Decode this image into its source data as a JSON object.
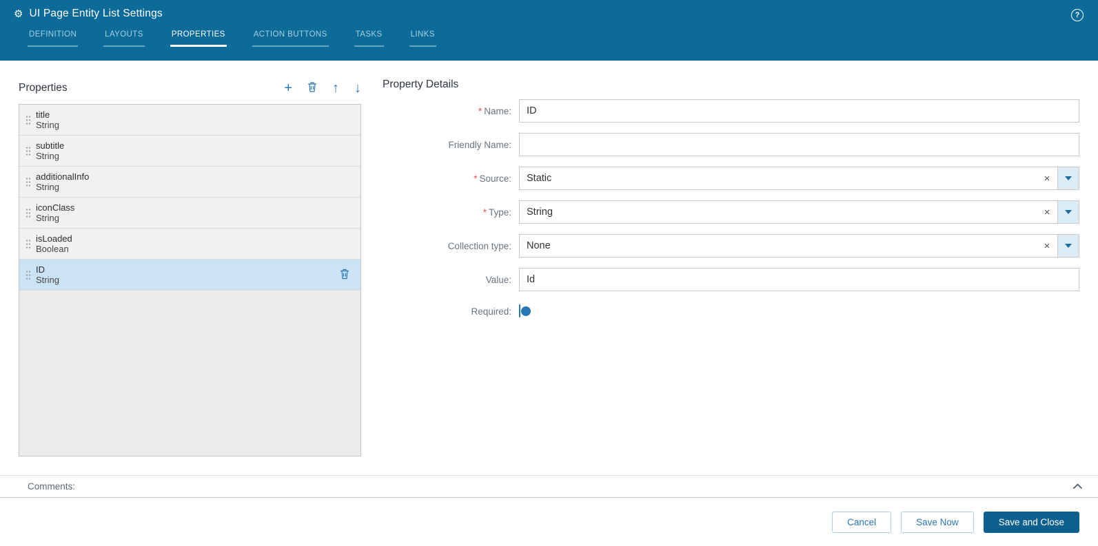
{
  "header": {
    "title": "UI Page Entity List Settings",
    "tabs": [
      {
        "label": "DEFINITION"
      },
      {
        "label": "LAYOUTS"
      },
      {
        "label": "PROPERTIES"
      },
      {
        "label": "ACTION BUTTONS"
      },
      {
        "label": "TASKS"
      },
      {
        "label": "LINKS"
      }
    ],
    "active_tab": "PROPERTIES"
  },
  "properties_panel": {
    "title": "Properties",
    "items": [
      {
        "name": "title",
        "type": "String"
      },
      {
        "name": "subtitle",
        "type": "String"
      },
      {
        "name": "additionalInfo",
        "type": "String"
      },
      {
        "name": "iconClass",
        "type": "String"
      },
      {
        "name": "isLoaded",
        "type": "Boolean"
      },
      {
        "name": "ID",
        "type": "String"
      }
    ],
    "selected_item": "ID"
  },
  "details_panel": {
    "title": "Property Details",
    "required_marker": "*",
    "fields": {
      "name": {
        "label": "Name:",
        "required": true,
        "value": "ID"
      },
      "friendly_name": {
        "label": "Friendly Name:",
        "required": false,
        "value": ""
      },
      "source": {
        "label": "Source:",
        "required": true,
        "value": "Static"
      },
      "type": {
        "label": "Type:",
        "required": true,
        "value": "String"
      },
      "collection_type": {
        "label": "Collection type:",
        "required": false,
        "value": "None"
      },
      "value": {
        "label": "Value:",
        "required": false,
        "value": "Id"
      },
      "required": {
        "label": "Required:",
        "state": "off"
      }
    }
  },
  "comments": {
    "label": "Comments:"
  },
  "footer": {
    "cancel_label": "Cancel",
    "save_now_label": "Save Now",
    "save_and_close_label": "Save and Close"
  },
  "glyphs": {
    "gear": "⚙",
    "help": "?",
    "add": "+",
    "move_up": "↑",
    "move_down": "↓",
    "clear": "×"
  },
  "colors": {
    "header_bg": "#0c6b99",
    "accent_blue": "#2878b6",
    "primary_button_bg": "#0f5f8e",
    "selected_row_bg": "#cbe4f5",
    "required_marker": "#d9534f"
  }
}
